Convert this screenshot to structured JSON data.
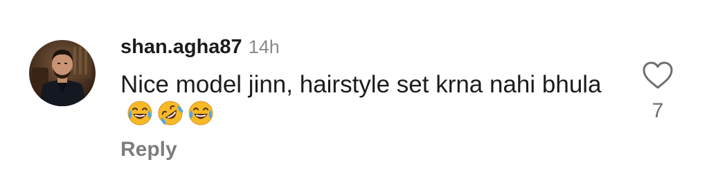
{
  "comment": {
    "username": "shan.agha87",
    "time": "14h",
    "text": "Nice model jinn, hairstyle set krna nahi bhula",
    "emojis": [
      "laughing-tears-emoji",
      "rolling-laughing-emoji",
      "laughing-tears-emoji"
    ],
    "reply_label": "Reply",
    "like_count": "7"
  },
  "icons": {
    "like": "heart-outline-icon"
  },
  "colors": {
    "username": "#1c1c1c",
    "timestamp": "#8a8a8a",
    "reply": "#7d7d7d",
    "like_count": "#6e6e6e",
    "emoji_face": "#f7b928"
  }
}
